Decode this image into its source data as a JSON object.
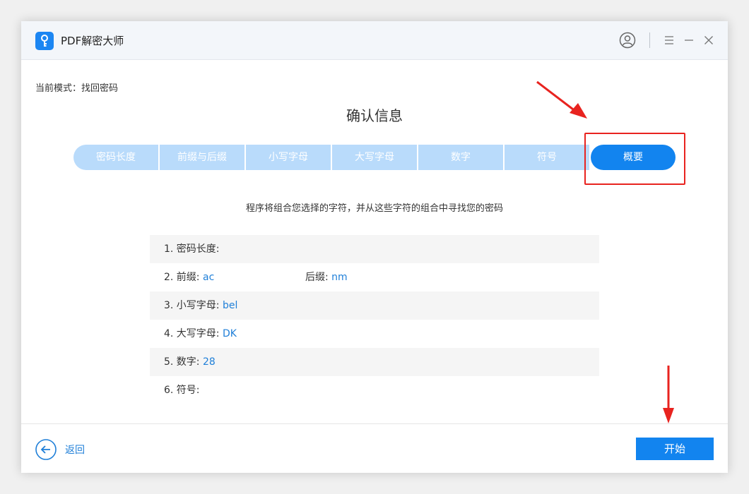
{
  "app": {
    "title": "PDF解密大师"
  },
  "mode": {
    "label": "当前模式：",
    "value": "找回密码"
  },
  "page_title": "确认信息",
  "steps": [
    {
      "label": "密码长度",
      "active": false
    },
    {
      "label": "前缀与后缀",
      "active": false
    },
    {
      "label": "小写字母",
      "active": false
    },
    {
      "label": "大写字母",
      "active": false
    },
    {
      "label": "数字",
      "active": false
    },
    {
      "label": "符号",
      "active": false
    },
    {
      "label": "概要",
      "active": true
    }
  ],
  "description": "程序将组合您选择的字符，并从这些字符的组合中寻找您的密码",
  "summary": {
    "length": {
      "label": "1. 密码长度:",
      "value": ""
    },
    "prefix": {
      "label": "2. 前缀:",
      "value": "ac"
    },
    "suffix": {
      "label": "后缀:",
      "value": "nm"
    },
    "lowercase": {
      "label": "3. 小写字母:",
      "value": "bel"
    },
    "uppercase": {
      "label": "4. 大写字母:",
      "value": "DK"
    },
    "digits": {
      "label": "5. 数字:",
      "value": "28"
    },
    "symbols": {
      "label": "6. 符号:",
      "value": ""
    }
  },
  "footer": {
    "back_label": "返回",
    "start_label": "开始"
  },
  "icons": {
    "app": "key-icon",
    "user": "user-icon",
    "menu": "menu-icon",
    "minimize": "minimize-icon",
    "close": "close-icon",
    "back": "back-arrow-icon"
  },
  "colors": {
    "accent": "#1284ef",
    "step_inactive": "#b9dbfb",
    "value_text": "#1f7fd8",
    "annotation": "#e8231f"
  }
}
